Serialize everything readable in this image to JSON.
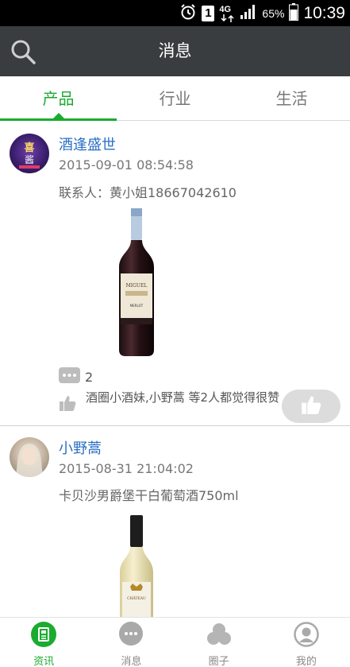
{
  "status_bar": {
    "network": "4G",
    "sim": "1",
    "battery": "65%",
    "time": "10:39"
  },
  "header": {
    "title": "消息",
    "search_icon": "search-icon"
  },
  "tabs": [
    {
      "label": "产品",
      "active": true
    },
    {
      "label": "行业",
      "active": false
    },
    {
      "label": "生活",
      "active": false
    }
  ],
  "posts": [
    {
      "author": "酒逢盛世",
      "time": "2015-09-01 08:54:58",
      "desc": "联系人：黄小姐18667042610",
      "comment_count": "2",
      "likes_text": "酒圈小酒妹,小野蒿 等2人都觉得很赞"
    },
    {
      "author": "小野蒿",
      "time": "2015-08-31 21:04:02",
      "desc": "卡贝沙男爵堡干白葡萄酒750ml"
    }
  ],
  "bottom_nav": [
    {
      "label": "资讯",
      "icon": "news-icon",
      "active": true
    },
    {
      "label": "消息",
      "icon": "message-icon",
      "active": false
    },
    {
      "label": "圈子",
      "icon": "circle-icon",
      "active": false
    },
    {
      "label": "我的",
      "icon": "profile-icon",
      "active": false
    }
  ],
  "colors": {
    "accent": "#1aab2f",
    "header_bg": "#3a3d40",
    "author_link": "#2a6fc4"
  }
}
